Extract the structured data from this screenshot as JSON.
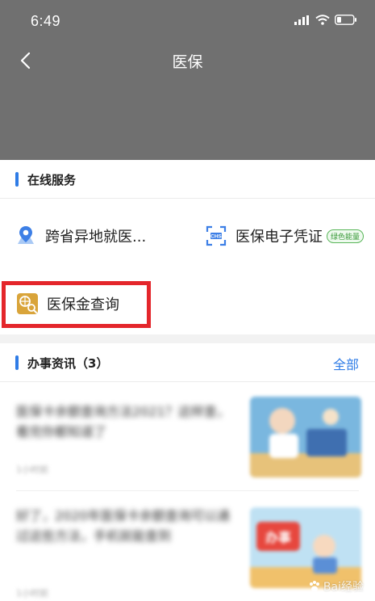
{
  "status_bar": {
    "time": "6:49"
  },
  "nav": {
    "title": "医保"
  },
  "online_services": {
    "title": "在线服务",
    "items": [
      {
        "label": "跨省异地就医...",
        "icon": "map-pin-icon",
        "icon_color": "#3d7fe6"
      },
      {
        "label": "医保电子凭证",
        "icon": "chs-qr-icon",
        "icon_color": "#3d7fe6",
        "badge": "绿色能量"
      },
      {
        "label": "医保金查询",
        "icon": "fund-query-icon",
        "icon_color": "#d9a43a"
      }
    ]
  },
  "news": {
    "title": "办事资讯（3）",
    "more_label": "全部",
    "items": [
      {
        "title": "医保卡余额查询方法2021？这样查，看完你都知道了",
        "meta": "1小时前"
      },
      {
        "title": "好了，2020年医保卡余额查询可以通过这些方法，手机就能查到",
        "meta": "1小时前"
      }
    ]
  },
  "watermark": {
    "text": "Bai经验"
  },
  "colors": {
    "accent": "#2f7ce6",
    "highlight": "#e4262b",
    "header_bg": "#707070"
  }
}
